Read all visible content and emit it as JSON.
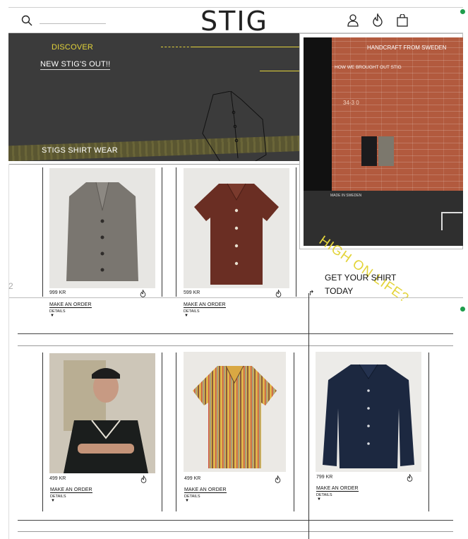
{
  "header": {
    "logo": "STIG",
    "icons": {
      "search": "search-icon",
      "account": "user-icon",
      "favorites": "flame-icon",
      "cart": "bag-icon"
    }
  },
  "hero": {
    "discover": "DISCOVER",
    "new_out": "NEW STIG'S OUT!!",
    "shirt_wear": "STIGS SHIRT WEAR",
    "handcraft": "HANDCRAFT FROM SWEDEN",
    "brought_out": "HOW WE BROUGHT OUT STIG",
    "photo_number": "34-3 0",
    "photo_caption": "HIGH ON LIFE?",
    "sign_text": "MADE IN SWEDEN"
  },
  "cta": {
    "text": "GET YOUR SHIRT TODAY"
  },
  "page_number": "2",
  "colors": {
    "accent": "#e3d43a",
    "dark": "#3b3b3b",
    "green_dot": "#1f9d4c"
  },
  "products": [
    {
      "price": "999 KR",
      "order": "MAKE AN ORDER",
      "details": "DETAILS"
    },
    {
      "price": "599 KR",
      "order": "MAKE AN ORDER",
      "details": "DETAILS"
    },
    {
      "price": "499 KR",
      "order": "MAKE AN ORDER",
      "details": "DETAILS"
    },
    {
      "price": "499 KR",
      "order": "MAKE AN ORDER",
      "details": "DETAILS"
    },
    {
      "price": "799 KR",
      "order": "MAKE AN ORDER",
      "details": "DETAILS"
    }
  ]
}
